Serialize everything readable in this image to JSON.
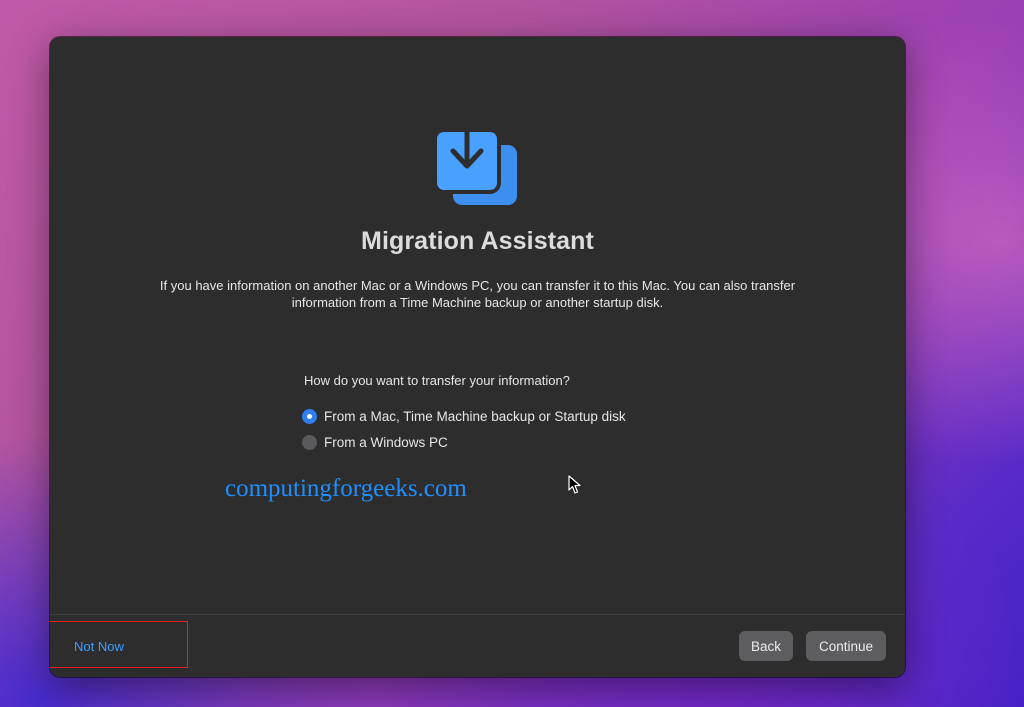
{
  "app": {
    "title": "Migration Assistant",
    "description": "If you have information on another Mac or a Windows PC, you can transfer it to this Mac. You can also transfer information from a Time Machine backup or another startup disk.",
    "icon": "migration-download-icon"
  },
  "transfer": {
    "question": "How do you want to transfer your information?",
    "options": [
      {
        "label": "From a Mac, Time Machine backup or Startup disk",
        "selected": true
      },
      {
        "label": "From a Windows PC",
        "selected": false
      }
    ]
  },
  "watermark": "computingforgeeks.com",
  "footer": {
    "not_now_label": "Not Now",
    "back_label": "Back",
    "continue_label": "Continue"
  },
  "colors": {
    "window_bg": "#2d2d2e",
    "accent": "#2f7ff0",
    "link": "#3c9cff",
    "button_bg": "#5d5d5f",
    "highlight": "#e02020",
    "watermark": "#1f8fff"
  }
}
